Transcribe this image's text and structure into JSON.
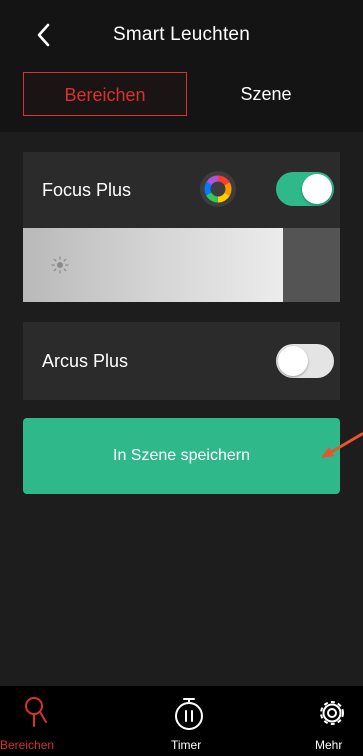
{
  "header": {
    "title": "Smart Leuchten",
    "back_icon": "chevron-left-icon"
  },
  "tabs": [
    {
      "label": "Bereichen",
      "active": true
    },
    {
      "label": "Szene",
      "active": false
    }
  ],
  "lights": [
    {
      "name": "Focus Plus",
      "on": true,
      "has_color_picker": true,
      "brightness_fraction": 0.82
    },
    {
      "name": "Arcus Plus",
      "on": false,
      "has_color_picker": false
    }
  ],
  "save_button": {
    "label": "In Szene speichern"
  },
  "bottom_nav": [
    {
      "label": "Bereichen",
      "icon": "area-pin-icon",
      "active": true
    },
    {
      "label": "Timer",
      "icon": "timer-icon",
      "active": false
    },
    {
      "label": "Mehr",
      "icon": "gear-icon",
      "active": false
    }
  ],
  "colors": {
    "accent_red": "#d8322e",
    "accent_green": "#2fb98a",
    "background": "#1d1d1d",
    "panel": "#2b2b2b"
  }
}
